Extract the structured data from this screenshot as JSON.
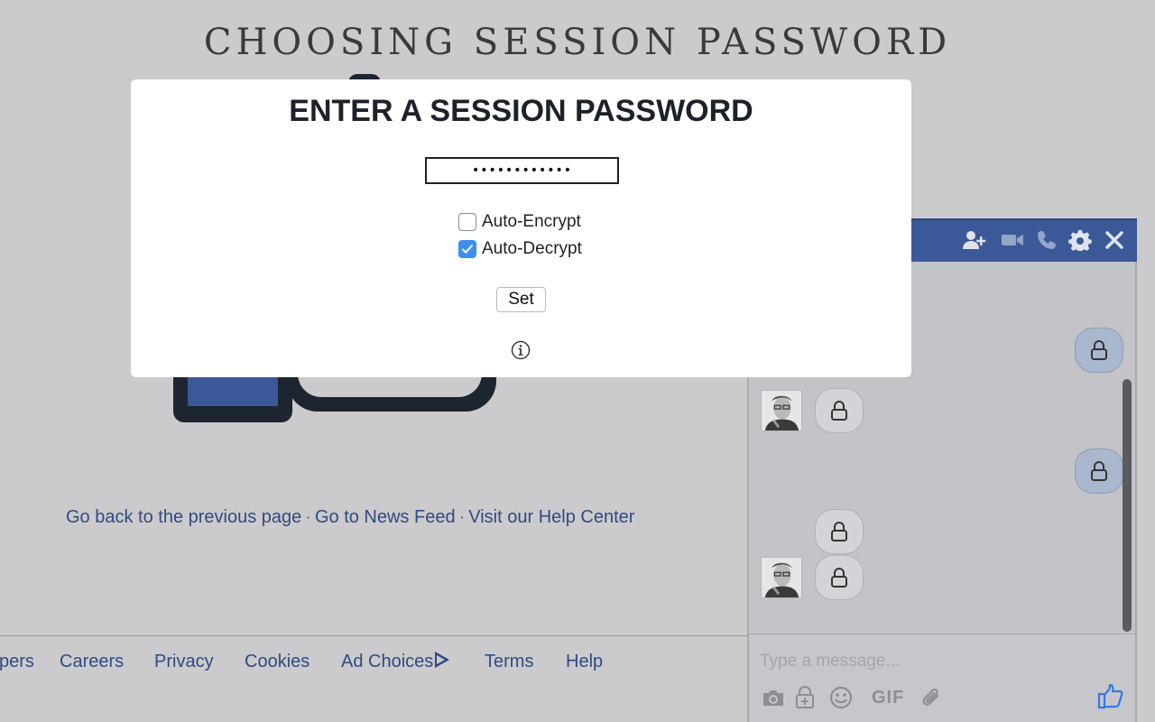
{
  "page": {
    "title": "CHOOSING SESSION PASSWORD"
  },
  "error_links": {
    "back": "Go back to the previous page",
    "separator": "·",
    "news_feed": "Go to News Feed",
    "help_center": "Visit our Help Center"
  },
  "footer": {
    "items": [
      "pers",
      "Careers",
      "Privacy",
      "Cookies",
      "Ad Choices",
      "Terms",
      "Help"
    ]
  },
  "modal": {
    "title": "ENTER A SESSION PASSWORD",
    "password_value": "••••••••••••",
    "auto_encrypt_label": "Auto-Encrypt",
    "auto_encrypt_checked": false,
    "auto_decrypt_label": "Auto-Decrypt",
    "auto_decrypt_checked": true,
    "set_label": "Set",
    "info_icon": "info-circle-icon"
  },
  "chat": {
    "header_icons": [
      "add-friend-icon",
      "video-call-icon",
      "voice-call-icon",
      "gear-icon",
      "close-icon"
    ],
    "messages": [
      {
        "direction": "outgoing",
        "content": "lock-icon"
      },
      {
        "direction": "incoming",
        "content": "lock-icon",
        "avatar": true
      },
      {
        "direction": "outgoing",
        "content": "lock-icon"
      },
      {
        "direction": "incoming",
        "content": "lock-icon",
        "avatar": false
      },
      {
        "direction": "incoming",
        "content": "lock-icon",
        "avatar": true
      }
    ],
    "composer_placeholder": "Type a message...",
    "tools": [
      "camera-icon",
      "sticker-icon",
      "emoji-icon",
      "GIF",
      "paperclip-icon",
      "thumbs-up-icon"
    ]
  },
  "colors": {
    "page_bg": "#cbcbcd",
    "link": "#2f4a82",
    "chat_header": "#3b5998",
    "checkbox_on": "#3d8ef0",
    "like": "#3578e5"
  }
}
